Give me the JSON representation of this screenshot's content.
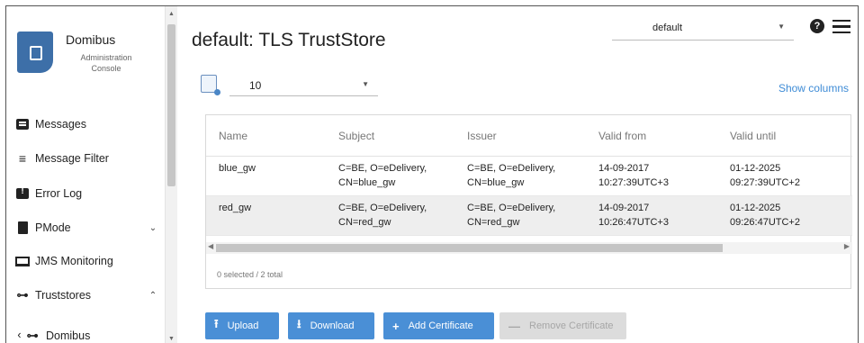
{
  "app": {
    "name": "Domibus",
    "subtitle": "Administration Console"
  },
  "sidebar": {
    "items": [
      {
        "label": "Messages",
        "icon": "message-icon"
      },
      {
        "label": "Message Filter",
        "icon": "filter-icon"
      },
      {
        "label": "Error Log",
        "icon": "error-icon"
      },
      {
        "label": "PMode",
        "icon": "file-icon",
        "chevron": "⌄"
      },
      {
        "label": "JMS Monitoring",
        "icon": "monitor-icon"
      },
      {
        "label": "Truststores",
        "icon": "key-icon",
        "chevron": "⌃"
      },
      {
        "label": "Domibus",
        "icon": "key-icon",
        "prefix": "‹"
      }
    ]
  },
  "header": {
    "title": "default: TLS TrustStore",
    "domain_selected": "default"
  },
  "toolbar": {
    "page_size": "10",
    "show_columns": "Show columns"
  },
  "table": {
    "columns": [
      "Name",
      "Subject",
      "Issuer",
      "Valid from",
      "Valid until"
    ],
    "rows": [
      {
        "name": "blue_gw",
        "subject_1": "C=BE, O=eDelivery,",
        "subject_2": "CN=blue_gw",
        "issuer_1": "C=BE, O=eDelivery,",
        "issuer_2": "CN=blue_gw",
        "from_1": "14-09-2017",
        "from_2": "10:27:39UTC+3",
        "until_1": "01-12-2025",
        "until_2": "09:27:39UTC+2"
      },
      {
        "name": "red_gw",
        "subject_1": "C=BE, O=eDelivery,",
        "subject_2": "CN=red_gw",
        "issuer_1": "C=BE, O=eDelivery,",
        "issuer_2": "CN=red_gw",
        "from_1": "14-09-2017",
        "from_2": "10:26:47UTC+3",
        "until_1": "01-12-2025",
        "until_2": "09:26:47UTC+2"
      }
    ],
    "footer": "0 selected / 2 total"
  },
  "actions": {
    "upload": "Upload",
    "download": "Download",
    "add_certificate": "Add Certificate",
    "remove_certificate": "Remove Certificate"
  },
  "colors": {
    "accent": "#4a8fd6",
    "link": "#3f8cd6",
    "logo": "#3d6fa8",
    "disabled": "#dcdcdc"
  }
}
